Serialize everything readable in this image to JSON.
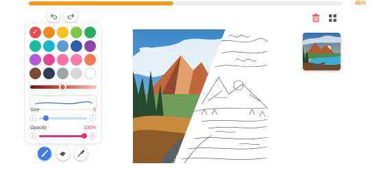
{
  "progress": {
    "percent_label": "46%",
    "fraction": 0.46
  },
  "history": {
    "undo_icon": "undo-icon",
    "redo_icon": "redo-icon"
  },
  "top_actions": {
    "delete_icon": "trash-icon",
    "grid_icon": "grid-icon"
  },
  "palette": {
    "selected_index": 0,
    "swatches": [
      "#e84e4e",
      "#f08a24",
      "#f4c320",
      "#7ac943",
      "#27ae60",
      "#1abc9c",
      "#14b8c8",
      "#5b9bd5",
      "#2c5faa",
      "#8e44ad",
      "#b05ad8",
      "#e84393",
      "#ff6fa8",
      "#fd79a8",
      "#f07c54",
      "#7a4a33",
      "#2d3e55",
      "#9ea4a8",
      "#d5d8da",
      "#ffffff"
    ]
  },
  "shade_slider": {
    "value": 0.5
  },
  "size": {
    "label": "Size",
    "value": "5",
    "minus": "‹",
    "plus": "›"
  },
  "opacity": {
    "label": "Opacity",
    "value": "100%",
    "minus": "‹",
    "plus": "›"
  },
  "tools": {
    "brush": "brush-icon",
    "eraser": "eraser-icon",
    "picker": "eyedropper-icon",
    "active": "brush"
  },
  "colors": {
    "accent": "#f39a1c",
    "primary": "#3c7ee6",
    "opacity_accent": "#e0356f"
  }
}
